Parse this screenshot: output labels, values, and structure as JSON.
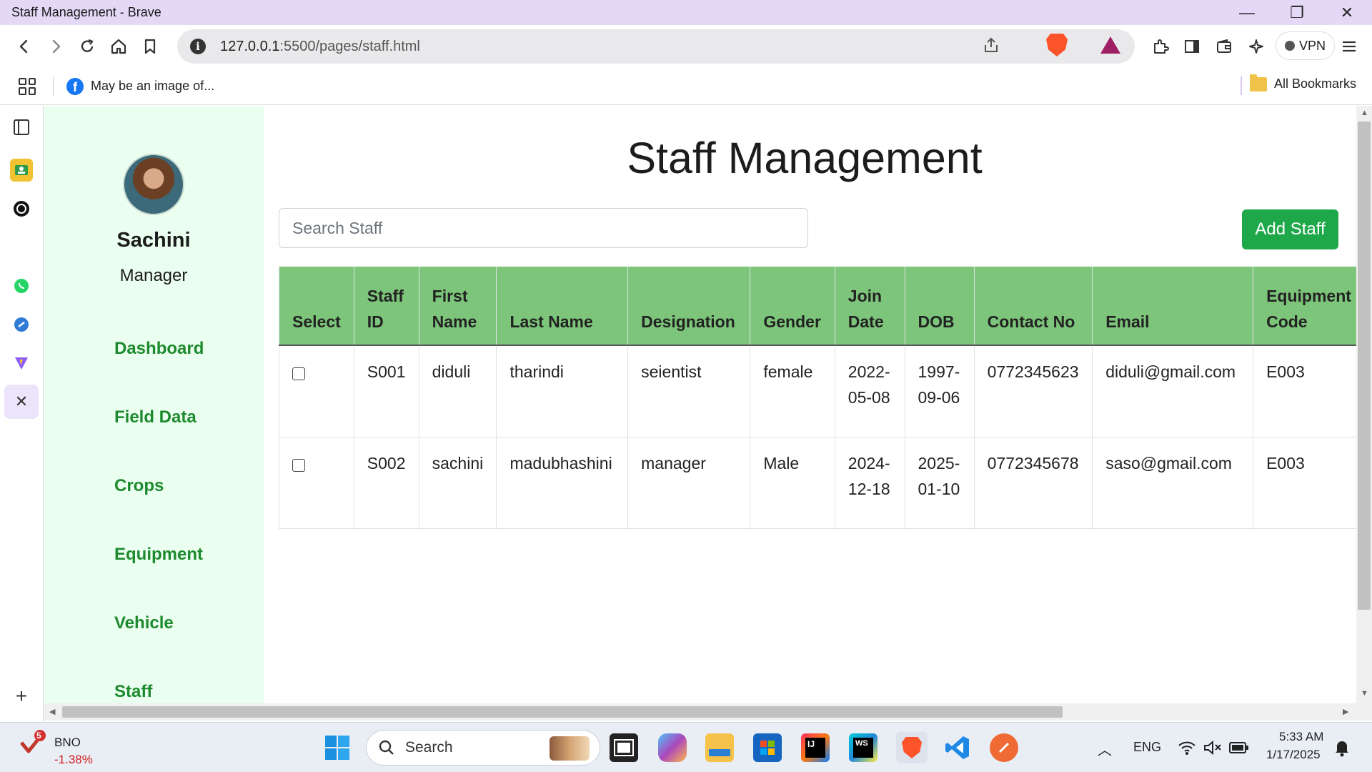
{
  "window": {
    "title": "Staff Management - Brave",
    "minimize": "—",
    "restore": "❐",
    "close": "✕"
  },
  "browser": {
    "url_host": "127.0.0.1",
    "url_path": ":5500/pages/staff.html",
    "vpn_label": "VPN"
  },
  "bookmarks": {
    "items": [
      {
        "label": "May be an image of...",
        "icon": "facebook-icon"
      }
    ],
    "all_label": "All Bookmarks"
  },
  "sidebar": {
    "user_name": "Sachini",
    "user_role": "Manager",
    "nav": [
      "Dashboard",
      "Field Data",
      "Crops",
      "Equipment",
      "Vehicle",
      "Staff"
    ]
  },
  "main": {
    "title": "Staff Management",
    "search_placeholder": "Search Staff",
    "add_button": "Add Staff",
    "table": {
      "headers": [
        "Select",
        "Staff ID",
        "First Name",
        "Last Name",
        "Designation",
        "Gender",
        "Join Date",
        "DOB",
        "Contact No",
        "Email",
        "Equipment Code"
      ],
      "rows": [
        [
          "",
          "S001",
          "diduli",
          "tharindi",
          "seientist",
          "female",
          "2022-05-08",
          "1997-09-06",
          "0772345623",
          "diduli@gmail.com",
          "E003"
        ],
        [
          "",
          "S002",
          "sachini",
          "madubhashini",
          "manager",
          "Male",
          "2024-12-18",
          "2025-01-10",
          "0772345678",
          "saso@gmail.com",
          "E003"
        ]
      ]
    }
  },
  "taskbar": {
    "stock_name": "BNO",
    "stock_change": "-1.38%",
    "stock_badge": "5",
    "search_label": "Search",
    "language": "ENG",
    "time": "5:33 AM",
    "date": "1/17/2025"
  },
  "colors": {
    "nav_green": "#1e8a2e",
    "header_green": "#7cc57a",
    "button_green": "#1fa84a",
    "sidebar_bg": "#eafff0",
    "titlebar": "#e3d9f7"
  }
}
